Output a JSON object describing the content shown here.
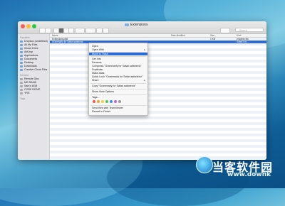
{
  "window": {
    "title": "Extensions"
  },
  "toolbar": {
    "search_placeholder": "Search"
  },
  "sidebar": {
    "sections": [
      {
        "header": "Favorites",
        "items": [
          "Dropbox (undefined)",
          "All My Files",
          "iCloud Drive",
          "AirDrop",
          "Applications",
          "Documents",
          "Desktop",
          "Downloads",
          "Creative Cloud Files"
        ]
      },
      {
        "header": "Devices",
        "items": [
          "Remote Disc",
          "MD RAM8",
          "Sam's 8GB",
          "CORE DRIVE",
          "YRS"
        ]
      },
      {
        "header": "Tags",
        "items": []
      }
    ]
  },
  "list": {
    "columns": [
      "Name",
      "Date Modified",
      "Size",
      "Kind"
    ],
    "rows": [
      {
        "name": "Extensions.plist",
        "date": "",
        "size": "1 KB",
        "kind": "property list"
      },
      {
        "name": "Grammarly for Safari.safariextz",
        "date": "",
        "size": "",
        "kind": "Safari Ext..."
      }
    ]
  },
  "context_menu": {
    "items": [
      "Open",
      "Open With",
      "Move to Trash",
      "Get Info",
      "Rename",
      "Compress \"Grammarly for Safari.safariextz\"",
      "Duplicate",
      "Make Alias",
      "Quick Look \"Grammarly for Safari.safariextz\"",
      "Share",
      "Copy \"Grammarly for Safari.safariextz\"",
      "Show View Options",
      "Tags...",
      "Send files with TeamViewer",
      "Reveal in Finder"
    ],
    "highlighted_index": 2,
    "tag_colors": [
      "#f35a4f",
      "#f6a230",
      "#f3d43a",
      "#5bc35b",
      "#3d8ef0",
      "#b66ad6",
      "#9a9a9a"
    ]
  },
  "watermark": {
    "cn": "当客软件园",
    "url": "www.downk"
  }
}
